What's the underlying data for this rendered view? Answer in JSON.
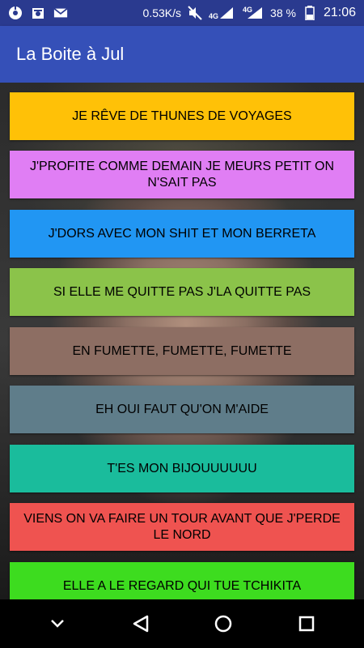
{
  "status_bar": {
    "network_speed": "0.53K/s",
    "net_label": "4G",
    "net_label_small": "4G",
    "battery": "38 %",
    "time": "21:06"
  },
  "app_bar": {
    "title": "La Boite à Jul"
  },
  "buttons": [
    {
      "label": "JE RÊVE DE THUNES DE VOYAGES",
      "color": "#FFC107"
    },
    {
      "label": "J'PROFITE COMME DEMAIN JE MEURS PETIT ON N'SAIT PAS",
      "color": "#E07EF4"
    },
    {
      "label": "J'DORS AVEC MON SHIT ET MON BERRETA",
      "color": "#2196F3"
    },
    {
      "label": "SI ELLE ME QUITTE PAS J'LA QUITTE PAS",
      "color": "#8BC34A"
    },
    {
      "label": "EN FUMETTE, FUMETTE, FUMETTE",
      "color": "#8D6E63"
    },
    {
      "label": "EH OUI FAUT QU'ON M'AIDE",
      "color": "#5F7D8A"
    },
    {
      "label": "T'ES MON BIJOUUUUUU",
      "color": "#1ABC9C"
    },
    {
      "label": "VIENS ON VA FAIRE UN TOUR AVANT QUE J'PERDE LE NORD",
      "color": "#EF5350"
    },
    {
      "label": "ELLE A LE REGARD QUI TUE TCHIKITA",
      "color": "#3DDC1F"
    }
  ],
  "nav_bar": {
    "icons": [
      "chevron-down-icon",
      "back-icon",
      "home-icon",
      "recents-icon"
    ]
  }
}
